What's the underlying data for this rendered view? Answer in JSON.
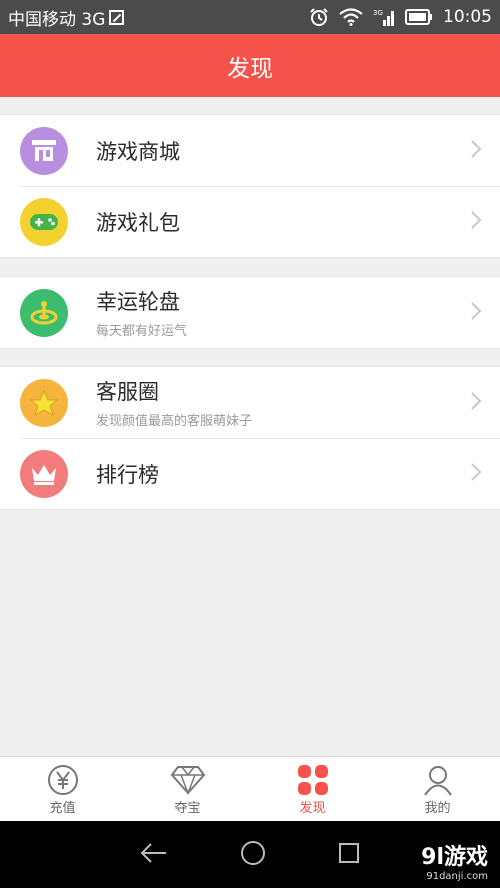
{
  "status_bar": {
    "carrier": "中国移动 3G",
    "time": "10:05",
    "icons": [
      "sim-icon",
      "alarm-icon",
      "wifi-icon",
      "signal-icon",
      "battery-icon"
    ]
  },
  "header": {
    "title": "发现"
  },
  "groups": [
    {
      "items": [
        {
          "title": "游戏商城",
          "subtitle": "",
          "icon": "shop-icon",
          "color": "#b98ee0"
        },
        {
          "title": "游戏礼包",
          "subtitle": "",
          "icon": "gamepad-icon",
          "color": "#f3d230"
        }
      ]
    },
    {
      "items": [
        {
          "title": "幸运轮盘",
          "subtitle": "每天都有好运气",
          "icon": "wheel-icon",
          "color": "#3cbc6e"
        }
      ]
    },
    {
      "items": [
        {
          "title": "客服圈",
          "subtitle": "发现颜值最高的客服萌妹子",
          "icon": "star-icon",
          "color": "#f5b53d"
        },
        {
          "title": "排行榜",
          "subtitle": "",
          "icon": "crown-icon",
          "color": "#f27b7b"
        }
      ]
    }
  ],
  "tabs": [
    {
      "label": "充值",
      "icon": "yen-icon",
      "active": false
    },
    {
      "label": "夺宝",
      "icon": "diamond-icon",
      "active": false
    },
    {
      "label": "发现",
      "icon": "discover-icon",
      "active": true
    },
    {
      "label": "我的",
      "icon": "user-icon",
      "active": false
    }
  ],
  "watermark": {
    "main": "9l游戏",
    "site": "91danji.com"
  },
  "colors": {
    "accent": "#f4524a",
    "status_bar": "#4b4b4b",
    "background": "#efefef"
  }
}
